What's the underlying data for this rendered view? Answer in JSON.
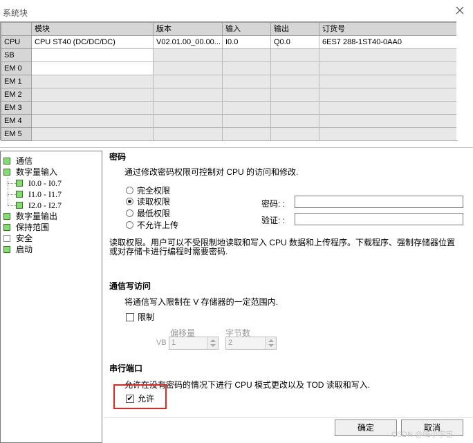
{
  "window": {
    "title": "系统块"
  },
  "grid": {
    "headers": [
      "",
      "模块",
      "版本",
      "输入",
      "输出",
      "订货号"
    ],
    "rows": [
      {
        "label": "CPU",
        "module": "CPU ST40 (DC/DC/DC)",
        "version": "V02.01.00_00.00...",
        "input": "I0.0",
        "output": "Q0.0",
        "order": "6ES7 288-1ST40-0AA0"
      },
      {
        "label": "SB",
        "module": "",
        "version": "",
        "input": "",
        "output": "",
        "order": ""
      },
      {
        "label": "EM 0",
        "module": "",
        "version": "",
        "input": "",
        "output": "",
        "order": ""
      },
      {
        "label": "EM 1",
        "module": "",
        "version": "",
        "input": "",
        "output": "",
        "order": ""
      },
      {
        "label": "EM 2",
        "module": "",
        "version": "",
        "input": "",
        "output": "",
        "order": ""
      },
      {
        "label": "EM 3",
        "module": "",
        "version": "",
        "input": "",
        "output": "",
        "order": ""
      },
      {
        "label": "EM 4",
        "module": "",
        "version": "",
        "input": "",
        "output": "",
        "order": ""
      },
      {
        "label": "EM 5",
        "module": "",
        "version": "",
        "input": "",
        "output": "",
        "order": ""
      }
    ]
  },
  "tree": {
    "items": [
      {
        "label": "通信",
        "enabled": true
      },
      {
        "label": "数字量输入",
        "enabled": true
      },
      {
        "label": "I0.0 - I0.7",
        "enabled": true
      },
      {
        "label": "I1.0 - I1.7",
        "enabled": true
      },
      {
        "label": "I2.0 - I2.7",
        "enabled": true
      },
      {
        "label": "数字量输出",
        "enabled": true
      },
      {
        "label": "保持范围",
        "enabled": true
      },
      {
        "label": "安全",
        "enabled": false
      },
      {
        "label": "启动",
        "enabled": true
      }
    ]
  },
  "password": {
    "title": "密码",
    "description": "通过修改密码权限可控制对 CPU 的访问和修改.",
    "options": [
      "完全权限",
      "读取权限",
      "最低权限",
      "不允许上传"
    ],
    "selected": "读取权限",
    "password_label": "密码: :",
    "verify_label": "验证: :",
    "note_line1": "读取权限。用户可以不受限制地读取和写入 CPU 数据和上传程序。下载程序、强制存储器位置",
    "note_line2": "或对存储卡进行编程时需要密码."
  },
  "comm_write": {
    "title": "通信写访问",
    "description": "将通信写入限制在 V 存储器的一定范围内.",
    "restrict_label": "限制",
    "restrict_checked": false,
    "offset_label": "偏移量",
    "bytes_label": "字节数",
    "vb_prefix": "VB",
    "offset_value": "1",
    "bytes_value": "2"
  },
  "serial": {
    "title": "串行端口",
    "description": "允许在没有密码的情况下进行 CPU 模式更改以及 TOD 读取和写入.",
    "allow_label": "允许",
    "allow_checked": true
  },
  "buttons": {
    "ok": "确定",
    "cancel": "取消"
  },
  "watermark": "CSDN @嗨小宇宙"
}
